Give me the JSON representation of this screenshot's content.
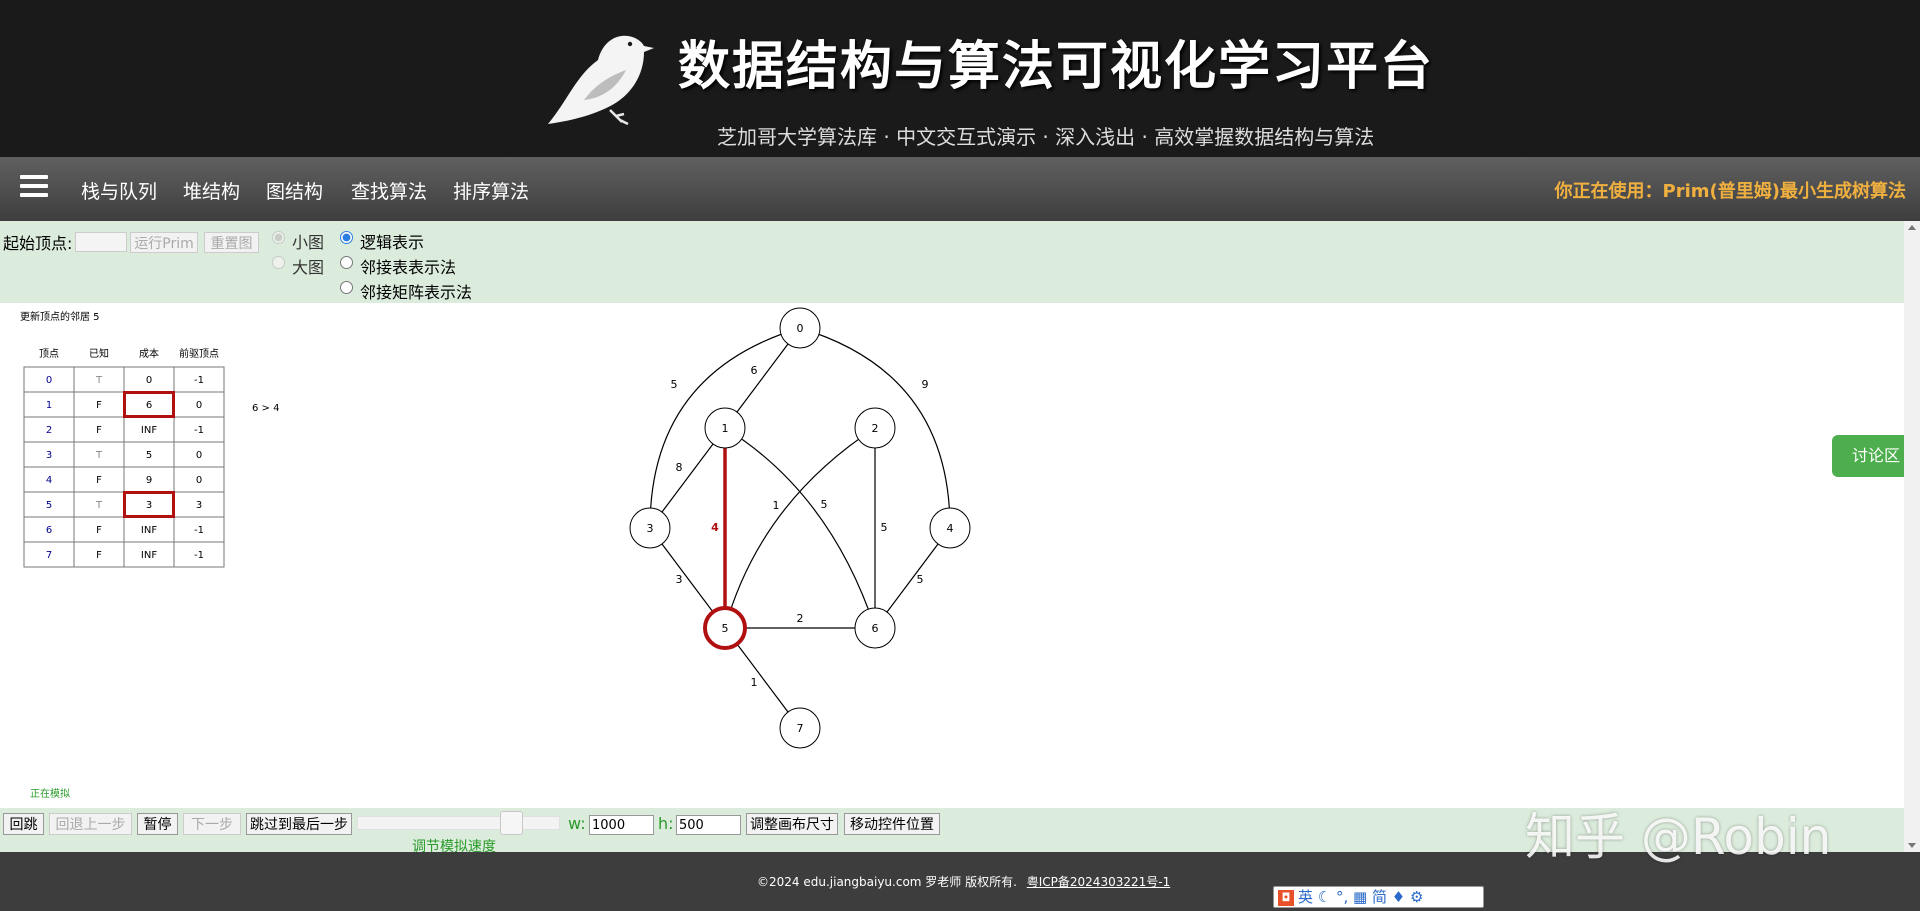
{
  "header": {
    "title": "数据结构与算法可视化学习平台",
    "subtitle": "芝加哥大学算法库 · 中文交互式演示 · 深入浅出 · 高效掌握数据结构与算法"
  },
  "nav": {
    "items": [
      "栈与队列",
      "堆结构",
      "图结构",
      "查找算法",
      "排序算法"
    ],
    "current": "你正在使用：Prim(普里姆)最小生成树算法"
  },
  "controls": {
    "start_label": "起始顶点:",
    "start_value": "",
    "run_label": "运行Prim",
    "reset_label": "重置图",
    "size_small": "小图",
    "size_large": "大图",
    "view_logical": "逻辑表示",
    "view_adjlist": "邻接表表示法",
    "view_matrix": "邻接矩阵表示法"
  },
  "canvas": {
    "status_top": "更新顶点的邻居 5",
    "compare": "6 > 4",
    "status_bottom": "正在模拟"
  },
  "table": {
    "headers": [
      "顶点",
      "已知",
      "成本",
      "前驱顶点"
    ],
    "rows": [
      [
        "0",
        "T",
        "0",
        "-1"
      ],
      [
        "1",
        "F",
        "6",
        "0"
      ],
      [
        "2",
        "F",
        "INF",
        "-1"
      ],
      [
        "3",
        "T",
        "5",
        "0"
      ],
      [
        "4",
        "F",
        "9",
        "0"
      ],
      [
        "5",
        "T",
        "3",
        "3"
      ],
      [
        "6",
        "F",
        "INF",
        "-1"
      ],
      [
        "7",
        "F",
        "INF",
        "-1"
      ]
    ],
    "highlighted_rows": [
      1,
      5
    ]
  },
  "graph": {
    "vertices": [
      "0",
      "1",
      "2",
      "3",
      "4",
      "5",
      "6",
      "7"
    ],
    "edges": [
      {
        "from": 0,
        "to": 1,
        "weight": "6"
      },
      {
        "from": 0,
        "to": 3,
        "weight": "5"
      },
      {
        "from": 0,
        "to": 4,
        "weight": "9"
      },
      {
        "from": 1,
        "to": 3,
        "weight": "8"
      },
      {
        "from": 1,
        "to": 5,
        "weight": "4",
        "highlight": true
      },
      {
        "from": 1,
        "to": 6,
        "weight": "5"
      },
      {
        "from": 2,
        "to": 5,
        "weight": "1"
      },
      {
        "from": 2,
        "to": 6,
        "weight": "5"
      },
      {
        "from": 3,
        "to": 5,
        "weight": "3"
      },
      {
        "from": 4,
        "to": 6,
        "weight": "5"
      },
      {
        "from": 5,
        "to": 6,
        "weight": "2"
      },
      {
        "from": 5,
        "to": 7,
        "weight": "1"
      }
    ],
    "highlight_vertex": 5,
    "colors": {
      "highlight": "#b01010",
      "known_text": "#888888",
      "index_text": "#00008b"
    }
  },
  "bottombar": {
    "restart": "回跳",
    "step_back": "回退上一步",
    "pause": "暂停",
    "step_forward": "下一步",
    "skip_end": "跳过到最后一步",
    "speed_label": "调节模拟速度",
    "w_label": "w:",
    "w_value": "1000",
    "h_label": "h:",
    "h_value": "500",
    "resize": "调整画布尺寸",
    "move_controls": "移动控件位置"
  },
  "footer": {
    "copyright": "©2024 edu.jiangbaiyu.com 罗老师 版权所有.",
    "icp": "粤ICP备2024303221号-1"
  },
  "discuss": "讨论区",
  "watermark": "知乎 @Robin",
  "ime_bar": "英 ☾ °, ▦ 简 ♦ ⚙"
}
